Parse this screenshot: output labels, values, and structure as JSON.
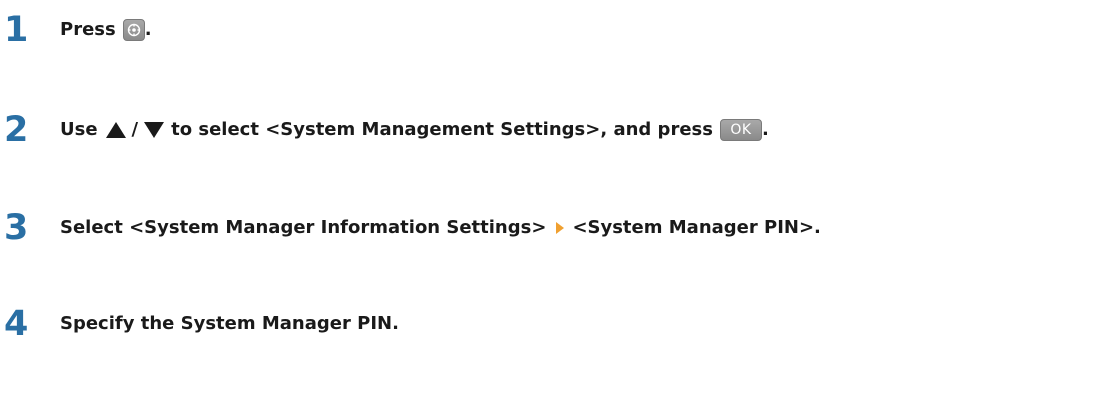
{
  "steps": [
    {
      "number": "1",
      "text_before": "Press",
      "text_after": "."
    },
    {
      "number": "2",
      "text_before": "Use",
      "slash": "/",
      "text_middle": "to select <System Management Settings>, and press",
      "ok_label": "OK",
      "text_after": "."
    },
    {
      "number": "3",
      "text_before": "Select <System Manager Information Settings>",
      "text_after": "<System Manager PIN>."
    },
    {
      "number": "4",
      "text": "Specify the System Manager PIN."
    }
  ],
  "icons": {
    "menu_key": "menu-key-icon",
    "up_arrow": "up-arrow-icon",
    "down_arrow": "down-arrow-icon",
    "next_arrow": "orange-right-arrow-icon"
  },
  "colors": {
    "step_number": "#2a6fa4",
    "text": "#1a1a1a",
    "key_button": "#8a8a8a",
    "next_arrow": "#f0a030"
  }
}
